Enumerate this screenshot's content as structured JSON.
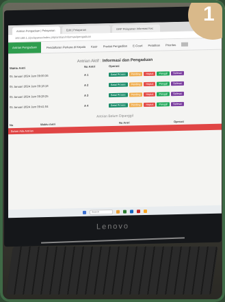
{
  "badge": {
    "label": "1"
  },
  "browser": {
    "tabs": [
      {
        "label": "Antrian Pengaduan | Pelayanan"
      },
      {
        "label": "Edit | Pelayanan"
      },
      {
        "label": "GRP Pelayanan Informasi Kec"
      }
    ],
    "address": "192.168.1.1/pelayanan/index.php/antrian/informasi/pengaduan"
  },
  "nav": {
    "home": "Antrian Pengaduan",
    "items": [
      "Pendaftaran Perkara di Kepala",
      "Kasir",
      "Produk Pengadilan",
      "E-Court",
      "Pelatihan",
      "Prioritas"
    ]
  },
  "main": {
    "title_prefix": "Antrian Aktif :",
    "title": "Informasi dan Pengaduan",
    "columns": [
      "Waktu Antri",
      "No Antri",
      "Operasi"
    ],
    "rows": [
      {
        "time": "05 Januari 2024 Jam 09:00:36",
        "no": "A 1"
      },
      {
        "time": "05 Januari 2024 Jam 09:18:18",
        "no": "A 2"
      },
      {
        "time": "05 Januari 2024 Jam 09:28:25",
        "no": "A 3"
      },
      {
        "time": "05 Januari 2024 Jam 09:41:04",
        "no": "A 4"
      }
    ],
    "buttons": {
      "process": "Batal Proses",
      "pending": "Pending",
      "delete": "Hapus",
      "call": "Panggil",
      "select": "Selesai"
    },
    "waiting_title": "Antrian Belum Dipanggil",
    "waiting_columns": [
      "No",
      "Waktu Antri",
      "No Antri",
      "Operasi"
    ],
    "empty": "Belum Ada Antrian"
  },
  "taskbar": {
    "search": "Search"
  },
  "monitor": {
    "brand": "Lenovo"
  }
}
